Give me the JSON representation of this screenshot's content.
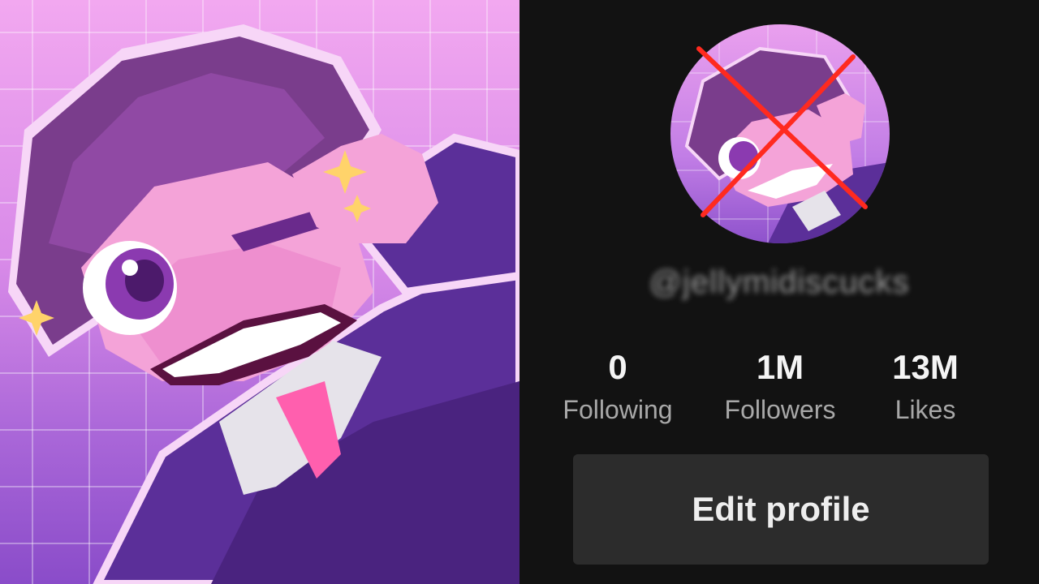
{
  "profile": {
    "username": "@jellymidiscucks",
    "stats": {
      "following": {
        "value": "0",
        "label": "Following"
      },
      "followers": {
        "value": "1M",
        "label": "Followers"
      },
      "likes": {
        "value": "13M",
        "label": "Likes"
      }
    },
    "edit_button_label": "Edit profile"
  },
  "colors": {
    "background": "#121212",
    "button": "#2c2c2c",
    "cross": "#ff2a1f",
    "accent_purple": "#a966d8"
  },
  "icons": {
    "avatar_overlay": "red-x-cross-icon"
  }
}
